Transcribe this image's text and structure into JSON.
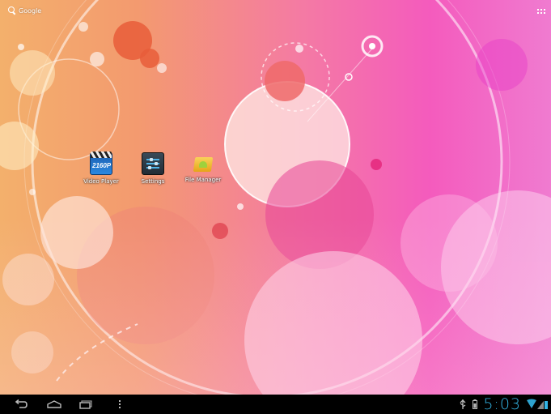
{
  "search": {
    "label": "Google",
    "icon": "search-icon"
  },
  "apps_button": {
    "icon": "all-apps-grid-icon"
  },
  "shortcuts": [
    {
      "label": "Video Player",
      "icon": "video-player-icon",
      "badge": "2160P"
    },
    {
      "label": "Settings",
      "icon": "settings-icon"
    },
    {
      "label": "File Manager",
      "icon": "file-manager-icon"
    }
  ],
  "navbar": {
    "back": "back-icon",
    "home": "home-icon",
    "recent": "recent-apps-icon",
    "menu": "menu-icon"
  },
  "status": {
    "time": "5:03",
    "usb_icon": "usb-icon",
    "battery_small_icon": "battery-icon",
    "wifi_icon": "wifi-icon",
    "signal_icon": "signal-icon",
    "battery_icon": "battery-level-icon",
    "accent_color": "#33b5e5"
  },
  "colors": {
    "wallpaper_left": "#f3b06c",
    "wallpaper_mid": "#f47aa4",
    "wallpaper_right": "#f07bd0",
    "navbar": "#000000"
  }
}
